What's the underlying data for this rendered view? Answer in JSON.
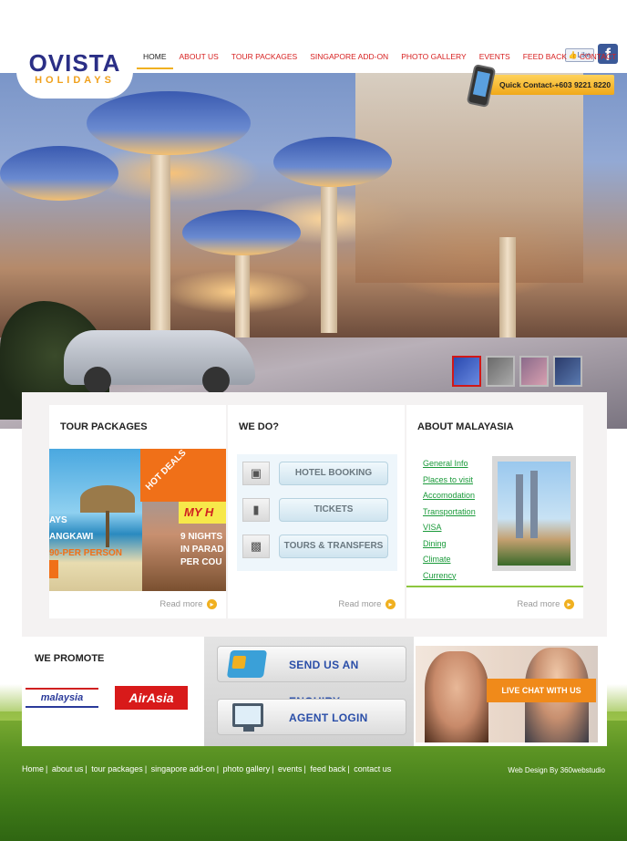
{
  "brand": {
    "name": "OVISTA",
    "tagline": "HOLIDAYS"
  },
  "nav": {
    "items": [
      {
        "label": "HOME",
        "active": true
      },
      {
        "label": "ABOUT US"
      },
      {
        "label": "TOUR PACKAGES"
      },
      {
        "label": "SINGAPORE ADD-ON"
      },
      {
        "label": "PHOTO GALLERY"
      },
      {
        "label": "EVENTS"
      },
      {
        "label": "FEED BACK"
      },
      {
        "label": "CONTACT"
      }
    ],
    "like_label": "Like",
    "fb_letter": "f"
  },
  "hero": {
    "quick_contact": "Quick Contact-+603 9221 8220",
    "thumbnail_count": 4,
    "active_thumbnail": 1
  },
  "tour_packages": {
    "title": "TOUR PACKAGES",
    "hot_deals": "HOT DEALS",
    "promo_left": [
      "AYS",
      "ANGKAWI",
      "90-PER PERSON"
    ],
    "promo_right_title": "MY H",
    "promo_right": [
      "9 NIGHTS",
      "IN PARAD",
      "PER COU"
    ],
    "read_more": "Read more"
  },
  "we_do": {
    "title": "WE DO?",
    "services": [
      {
        "icon": "bed-icon",
        "label": "HOTEL BOOKING"
      },
      {
        "icon": "ticket-icon",
        "label": "TICKETS"
      },
      {
        "icon": "car-icon",
        "label": "TOURS & TRANSFERS"
      }
    ],
    "read_more": "Read more"
  },
  "about_malaysia": {
    "title": "ABOUT MALAYASIA",
    "links": [
      "General Info",
      "Places to visit",
      "Accomodation",
      "Transportation",
      "VISA",
      "Dining",
      "Climate",
      "Currency"
    ],
    "read_more": "Read more"
  },
  "promote": {
    "title": "WE PROMOTE",
    "partners": [
      "malaysia",
      "AirAsia"
    ]
  },
  "actions": {
    "enquiry": "SEND US AN ENQUIRY",
    "agent_login": "AGENT LOGIN"
  },
  "livechat": {
    "label": "LIVE CHAT WITH US"
  },
  "footer": {
    "links": [
      "Home",
      "about us",
      "tour packages",
      "singapore add-on",
      "photo gallery",
      "events",
      "feed back",
      "contact us"
    ],
    "credit": "Web Design By 360webstudio"
  },
  "colors": {
    "brand_blue": "#2b2f86",
    "brand_gold": "#f0a11c",
    "nav_red": "#d72020",
    "accent_orange": "#f07018",
    "link_green": "#1a9a3a"
  }
}
